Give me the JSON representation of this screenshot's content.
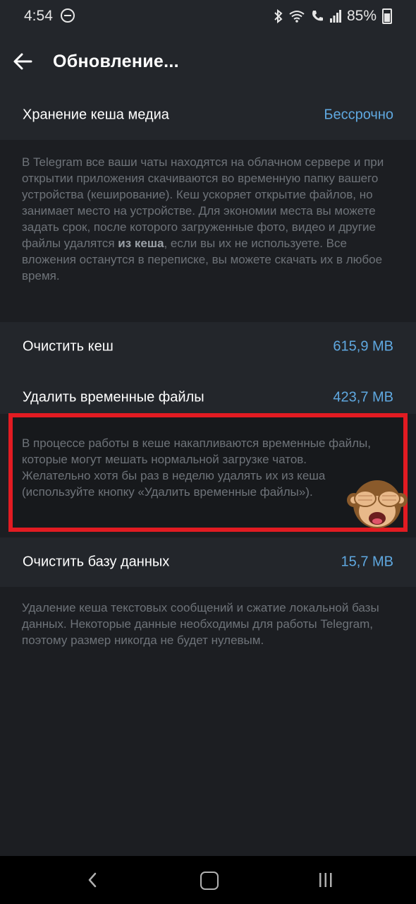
{
  "status_bar": {
    "time": "4:54",
    "battery": "85%",
    "icons": [
      "do-not-disturb-icon",
      "bluetooth-icon",
      "wifi-icon",
      "call-icon",
      "signal-icon",
      "battery-icon"
    ]
  },
  "app_bar": {
    "title": "Обновление..."
  },
  "cache_storage": {
    "label": "Хранение кеша медиа",
    "value": "Бессрочно"
  },
  "cache_info": {
    "text_before": "В Telegram все ваши чаты находятся на облачном сервере и при открытии приложения скачиваются во временную папку вашего устройства (кеширование). Кеш ускоряет открытие файлов, но занимает место на устройстве. Для экономии места вы можете задать срок, после которого загруженные фото, видео и другие файлы удалятся ",
    "text_bold": "из кеша",
    "text_after": ", если вы их не используете. Все вложения останутся в переписке, вы можете скачать их в любое время."
  },
  "clear_cache": {
    "label": "Очистить кеш",
    "value": "615,9 MB"
  },
  "delete_temp": {
    "label": "Удалить временные файлы",
    "value": "423,7 MB"
  },
  "temp_info": {
    "text": "В процессе работы в кеше накапливаются временные файлы, которые могут мешать нормальной загрузке чатов. Желательно хотя бы раз в неделю удалять их из кеша (используйте кнопку «Удалить временные файлы»)."
  },
  "clear_db": {
    "label": "Очистить базу данных",
    "value": "15,7 MB"
  },
  "db_info": {
    "text": "Удаление кеша текстовых сообщений и сжатие локальной базы данных. Некоторые данные необходимы для работы Telegram, поэтому размер никогда не будет нулевым."
  },
  "colors": {
    "background": "#1c1e22",
    "surface": "#23262b",
    "accent": "#5fa8e0",
    "highlight_border": "#e21b22",
    "hint_text": "#6e7379"
  },
  "nav_bar": {
    "icons": [
      "nav-back-icon",
      "nav-home-icon",
      "nav-recents-icon"
    ]
  }
}
